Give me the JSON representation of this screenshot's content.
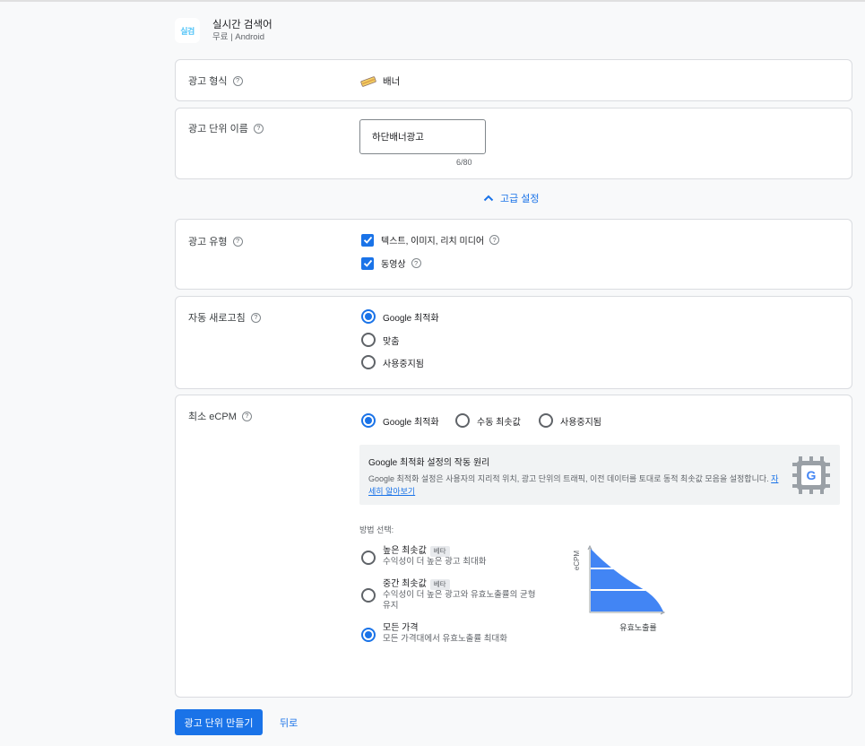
{
  "app": {
    "icon_text": "실검",
    "name": "실시간 검색어",
    "subtitle": "무료 | Android"
  },
  "format": {
    "label": "광고 형식",
    "value": "배너",
    "icon": "banner-icon"
  },
  "unit_name": {
    "label": "광고 단위 이름",
    "value": "하단배너광고",
    "counter": "6/80"
  },
  "advanced": {
    "label": "고급 설정",
    "icon": "chevron-up-icon"
  },
  "ad_type": {
    "label": "광고 유형",
    "options": [
      {
        "label": "텍스트, 이미지, 리치 미디어",
        "checked": true
      },
      {
        "label": "동영상",
        "checked": true
      }
    ]
  },
  "refresh": {
    "label": "자동 새로고침",
    "options": [
      {
        "label": "Google 최적화",
        "selected": true
      },
      {
        "label": "맞춤",
        "selected": false
      },
      {
        "label": "사용중지됨",
        "selected": false
      }
    ]
  },
  "ecpm": {
    "label": "최소 eCPM",
    "options": [
      {
        "label": "Google 최적화",
        "selected": true
      },
      {
        "label": "수동 최솟값",
        "selected": false
      },
      {
        "label": "사용중지됨",
        "selected": false
      }
    ],
    "info": {
      "title": "Google 최적화 설정의 작동 원리",
      "body": "Google 최적화 설정은 사용자의 지리적 위치, 광고 단위의 트래픽, 이전 데이터를 토대로 동적 최솟값 모음을 설정합니다.",
      "link": "자세히 알아보기",
      "icon": "google-chip-icon"
    },
    "method_caption": "방법 선택:",
    "methods": [
      {
        "title": "높은 최솟값",
        "badge": "베타",
        "desc": "수익성이 더 높은 광고 최대화",
        "selected": false
      },
      {
        "title": "중간 최솟값",
        "badge": "베타",
        "desc": "수익성이 더 높은 광고와 유효노출률의 균형 유지",
        "selected": false
      },
      {
        "title": "모든 가격",
        "badge": "",
        "desc": "모든 가격대에서 유효노출률 최대화",
        "selected": true
      }
    ],
    "diagram": {
      "ylabel": "eCPM",
      "xlabel": "유효노출률",
      "fill_color": "#4285f4"
    }
  },
  "actions": {
    "create": "광고 단위 만들기",
    "back": "뒤로"
  },
  "colors": {
    "accent": "#1a73e8",
    "border": "#dadce0"
  }
}
